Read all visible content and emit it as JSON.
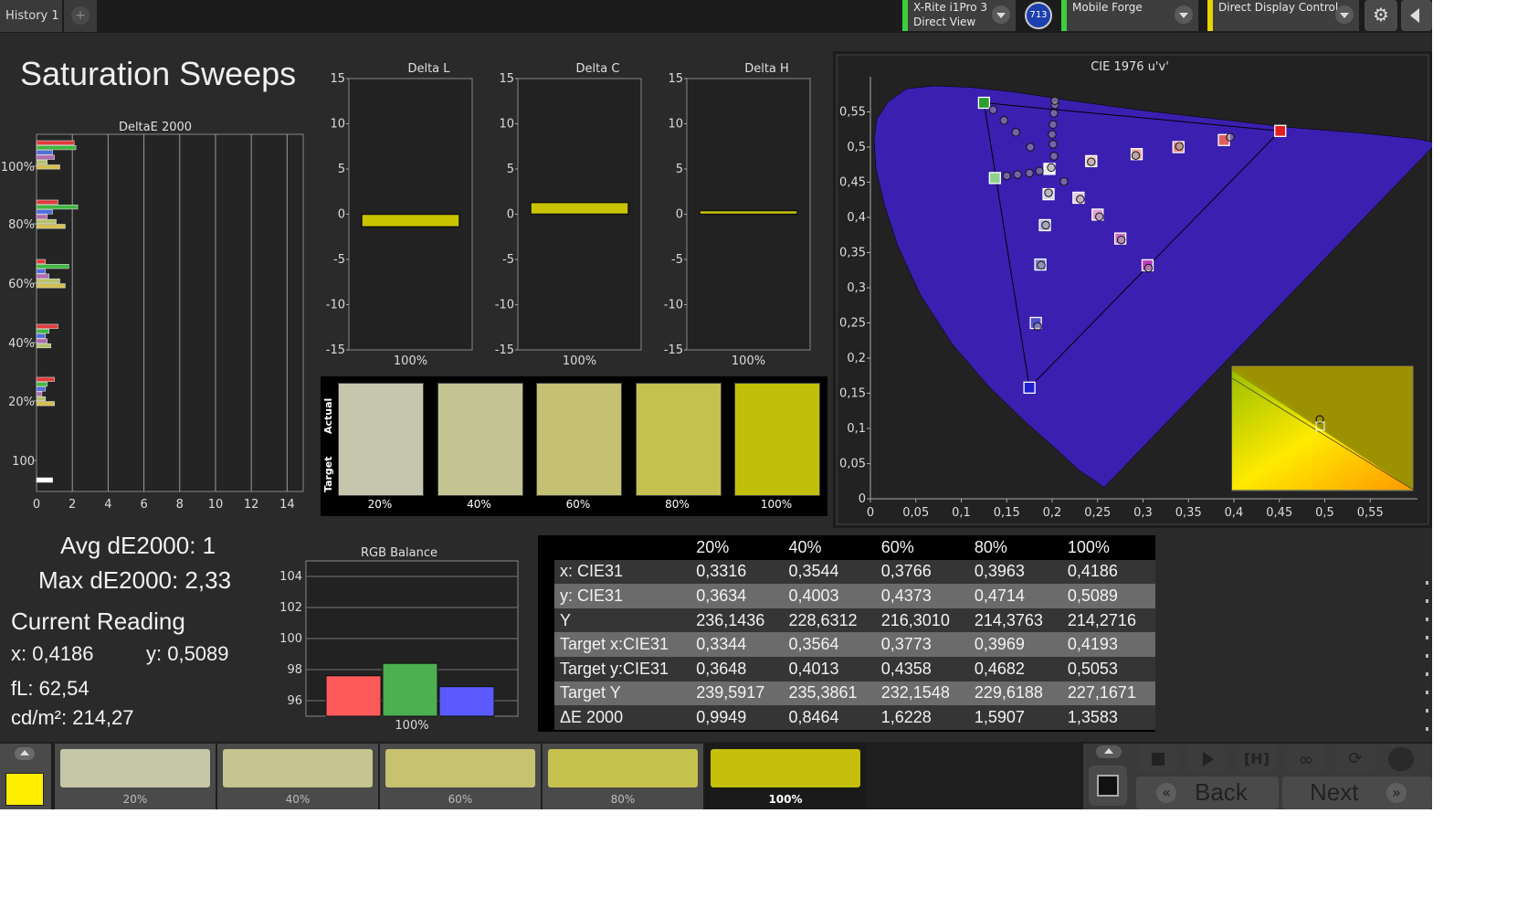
{
  "tabs": {
    "history": "History 1",
    "add": "+"
  },
  "devices": {
    "meter": {
      "line1": "X-Rite i1Pro 3",
      "line2": "Direct View"
    },
    "badge": "713",
    "profile": "Mobile Forge",
    "display": "Direct Display Control"
  },
  "page_title": "Saturation Sweeps",
  "deltae_chart": {
    "title": "DeltaE 2000",
    "x_ticks": [
      "0",
      "2",
      "4",
      "6",
      "8",
      "10",
      "12",
      "14"
    ],
    "y_labels": [
      "100%",
      "80%",
      "60%",
      "40%",
      "20%",
      "100"
    ]
  },
  "delta_charts": [
    {
      "title": "Delta L",
      "value": -1.4,
      "xlabel": "100%"
    },
    {
      "title": "Delta C",
      "value": 1.3,
      "xlabel": "100%"
    },
    {
      "title": "Delta H",
      "value": 0.4,
      "xlabel": "100%"
    }
  ],
  "delta_ticks": [
    "15",
    "10",
    "5",
    "0",
    "-5",
    "-10",
    "-15"
  ],
  "swatches": {
    "actual_label": "Actual",
    "target_label": "Target",
    "items": [
      {
        "label": "20%",
        "color": "#c5c6ad"
      },
      {
        "label": "40%",
        "color": "#c4c492"
      },
      {
        "label": "60%",
        "color": "#c4c172"
      },
      {
        "label": "80%",
        "color": "#c4c150"
      },
      {
        "label": "100%",
        "color": "#c2bf0b"
      }
    ]
  },
  "cie": {
    "title": "CIE 1976 u'v'",
    "x_ticks": [
      "0",
      "0,05",
      "0,1",
      "0,15",
      "0,2",
      "0,25",
      "0,3",
      "0,35",
      "0,4",
      "0,45",
      "0,5",
      "0,55"
    ],
    "y_ticks": [
      "0",
      "0,05",
      "0,1",
      "0,15",
      "0,2",
      "0,25",
      "0,3",
      "0,35",
      "0,4",
      "0,45",
      "0,5",
      "0,55"
    ]
  },
  "stats": {
    "avg": "Avg dE2000: 1",
    "max": "Max dE2000: 2,33",
    "current_reading": "Current Reading",
    "x": "x: 0,4186",
    "y": "y: 0,5089",
    "fl": "fL: 62,54",
    "cdm2": "cd/m²: 214,27"
  },
  "rgb_balance": {
    "title": "RGB Balance",
    "y_ticks": [
      "104",
      "102",
      "100",
      "98",
      "96"
    ],
    "xlabel": "100%",
    "bars": [
      {
        "name": "R",
        "value": 97.6,
        "color": "#ff5a5a"
      },
      {
        "name": "G",
        "value": 98.4,
        "color": "#4caf50"
      },
      {
        "name": "B",
        "value": 96.9,
        "color": "#5a5aff"
      }
    ]
  },
  "table": {
    "headers": [
      "",
      "20%",
      "40%",
      "60%",
      "80%",
      "100%"
    ],
    "rows": [
      [
        "x: CIE31",
        "0,3316",
        "0,3544",
        "0,3766",
        "0,3963",
        "0,4186"
      ],
      [
        "y: CIE31",
        "0,3634",
        "0,4003",
        "0,4373",
        "0,4714",
        "0,5089"
      ],
      [
        "Y",
        "236,1436",
        "228,6312",
        "216,3010",
        "214,3763",
        "214,2716"
      ],
      [
        "Target x:CIE31",
        "0,3344",
        "0,3564",
        "0,3773",
        "0,3969",
        "0,4193"
      ],
      [
        "Target y:CIE31",
        "0,3648",
        "0,4013",
        "0,4358",
        "0,4682",
        "0,5053"
      ],
      [
        "Target Y",
        "239,5917",
        "235,3861",
        "232,1548",
        "229,6188",
        "227,1671"
      ],
      [
        "ΔE 2000",
        "0,9949",
        "0,8464",
        "1,6228",
        "1,5907",
        "1,3583"
      ]
    ]
  },
  "patch_strip": {
    "current_color": "#ffee00",
    "items": [
      {
        "label": "20%",
        "color": "#c6c6a8"
      },
      {
        "label": "40%",
        "color": "#c6c48f"
      },
      {
        "label": "60%",
        "color": "#c6c270"
      },
      {
        "label": "80%",
        "color": "#c6c24e"
      },
      {
        "label": "100%",
        "color": "#c4bf0a"
      }
    ]
  },
  "nav": {
    "back": "Back",
    "next": "Next"
  }
}
